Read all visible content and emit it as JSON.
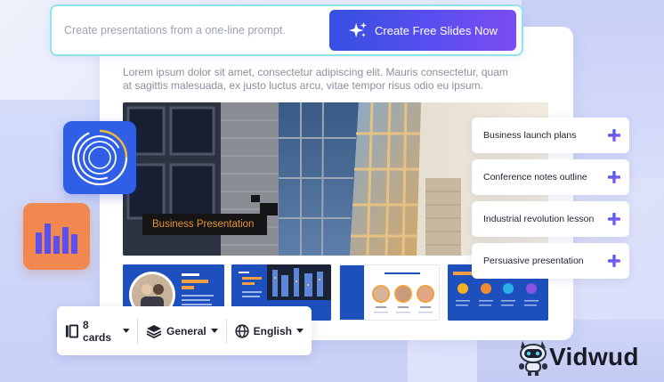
{
  "prompt": {
    "placeholder": "Create presentations from a one-line prompt.",
    "cta_label": "Create Free Slides Now"
  },
  "description": "Lorem ipsum dolor sit amet, consectetur adipiscing elit. Mauris consectetur, quam at sagittis malesuada, ex justo luctus arcu, vitae tempor risus odio eu ipsum.",
  "hero": {
    "caption": "Business Presentation"
  },
  "suggestions": [
    {
      "label": "Business launch plans"
    },
    {
      "label": "Conference notes outline"
    },
    {
      "label": "Industrial revolution lesson"
    },
    {
      "label": "Persuasive presentation"
    }
  ],
  "options": {
    "cards": "8 cards",
    "style": "General",
    "language": "English"
  },
  "brand": {
    "name": "Vidwud"
  },
  "colors": {
    "cta_start": "#3550e0",
    "cta_end": "#7b4cf2",
    "prompt_border": "#8fe3ea",
    "caption_text": "#e89134",
    "thumb_blue": "#1d4fbd",
    "ring_icon_bg": "#2f5fe6",
    "chart_icon_bg": "#f08850"
  },
  "icons": {
    "cta": "sparkle-icon",
    "suggestion": "plus-icon",
    "cards": "cards-icon",
    "style": "layers-icon",
    "language": "globe-icon",
    "dropdown": "chevron-down-icon"
  }
}
